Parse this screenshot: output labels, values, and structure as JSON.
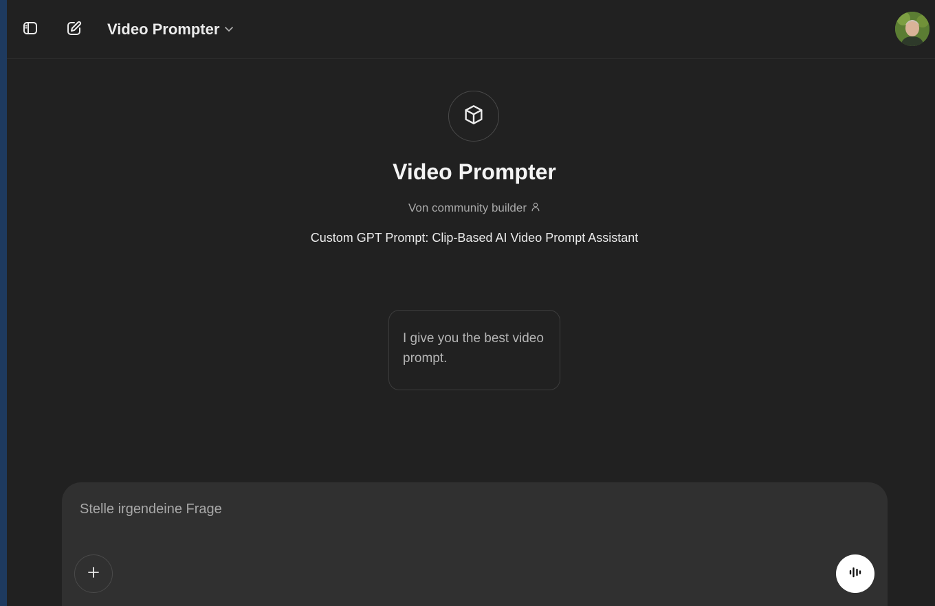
{
  "header": {
    "model_name": "Video Prompter",
    "icons": {
      "sidebar_toggle": "sidebar-toggle-icon",
      "new_chat": "edit-icon",
      "dropdown": "chevron-down-icon"
    }
  },
  "gpt": {
    "icon": "cube-icon",
    "title": "Video Prompter",
    "author": "Von community builder",
    "author_icon": "person-icon",
    "description": "Custom GPT Prompt: Clip-Based AI Video Prompt Assistant"
  },
  "starters": [
    {
      "text": "I give you the best video prompt."
    }
  ],
  "composer": {
    "placeholder": "Stelle irgendeine Frage",
    "value": "",
    "add_icon": "plus-icon",
    "voice_icon": "voice-wave-icon"
  },
  "colors": {
    "background": "#212121",
    "composer": "#303030",
    "left_strip": "#1e3a5f",
    "text": "#ececec",
    "muted": "#a8a8a8"
  }
}
